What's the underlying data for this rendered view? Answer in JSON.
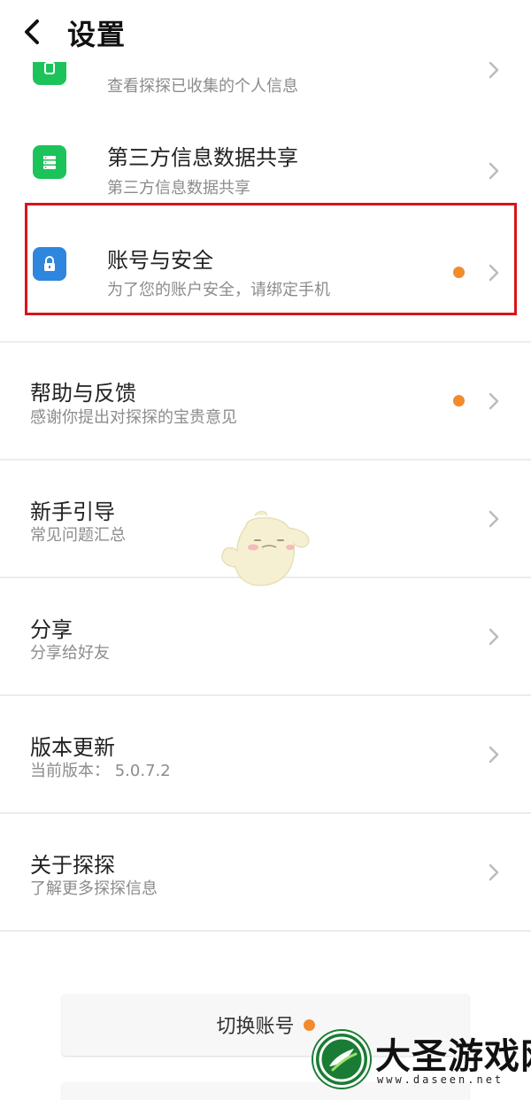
{
  "header": {
    "title": "设置"
  },
  "colors": {
    "green": "#1cc35a",
    "blue": "#2e86de",
    "orange": "#f28a2e",
    "highlight": "#d8141b"
  },
  "items": [
    {
      "key": "personal-info",
      "icon": "shield-icon",
      "title": "",
      "subtitle": "查看探探已收集的个人信息"
    },
    {
      "key": "third-party-sharing",
      "icon": "database-icon",
      "title": "第三方信息数据共享",
      "subtitle": "第三方信息数据共享"
    },
    {
      "key": "account-security",
      "icon": "lock-icon",
      "title": "账号与安全",
      "subtitle": "为了您的账户安全，请绑定手机",
      "badge": true
    },
    {
      "key": "help-feedback",
      "title": "帮助与反馈",
      "subtitle": "感谢你提出对探探的宝贵意见",
      "badge": true
    },
    {
      "key": "newbie-guide",
      "title": "新手引导",
      "subtitle": "常见问题汇总"
    },
    {
      "key": "share",
      "title": "分享",
      "subtitle": "分享给好友"
    },
    {
      "key": "version-update",
      "title": "版本更新",
      "subtitle": "当前版本： 5.0.7.2"
    },
    {
      "key": "about",
      "title": "关于探探",
      "subtitle": "了解更多探探信息"
    }
  ],
  "buttons": {
    "switch_account": "切换账号"
  },
  "watermark": {
    "brand": "大圣游戏网",
    "url": "www.daseen.net"
  }
}
